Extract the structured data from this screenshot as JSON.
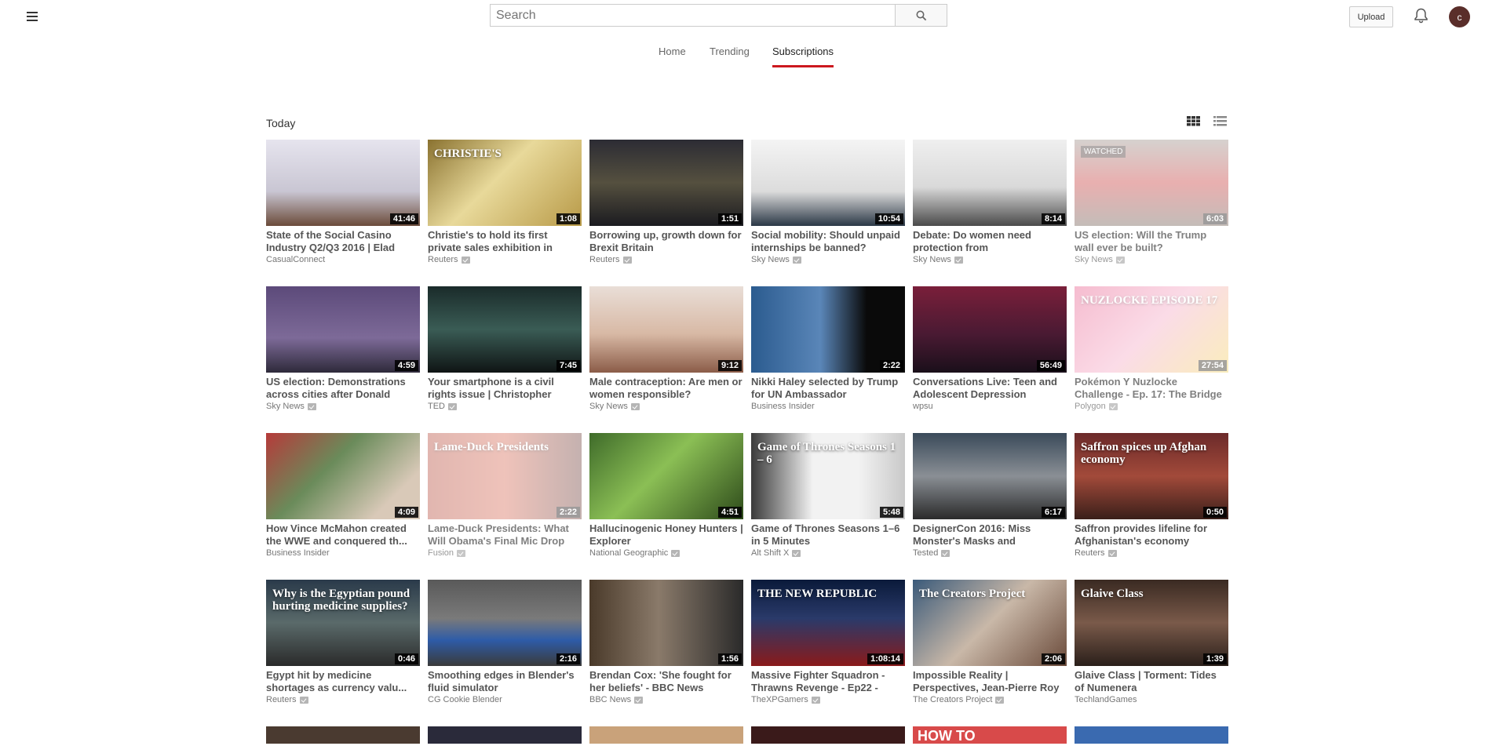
{
  "header": {
    "search_placeholder": "Search",
    "upload_label": "Upload",
    "avatar_initial": "c"
  },
  "tabs": [
    {
      "label": "Home",
      "active": false
    },
    {
      "label": "Trending",
      "active": false
    },
    {
      "label": "Subscriptions",
      "active": true
    }
  ],
  "section": {
    "title": "Today"
  },
  "accent_color": "#cc181e",
  "rows": [
    [
      {
        "title": "State of the Social Casino Industry Q2/Q3 2016 | Elad",
        "channel": "CasualConnect",
        "verified": false,
        "duration": "41:46",
        "bg": "linear-gradient(180deg,#e6e4ee 0%,#c9c6d3 60%,#6b4b3a 100%)"
      },
      {
        "title": "Christie's to hold its first private sales exhibition in",
        "channel": "Reuters",
        "verified": true,
        "duration": "1:08",
        "bg": "linear-gradient(135deg,#8a7230 0%,#e8d99a 45%,#b89a48 100%)",
        "thumb_text": "CHRISTIE'S"
      },
      {
        "title": "Borrowing up, growth down for Brexit Britain",
        "channel": "Reuters",
        "verified": true,
        "duration": "1:51",
        "bg": "linear-gradient(180deg,#2c2c34 0%,#55503f 50%,#1b1b20 100%)"
      },
      {
        "title": "Social mobility: Should unpaid internships be banned?",
        "channel": "Sky News",
        "verified": true,
        "duration": "10:54",
        "bg": "linear-gradient(180deg,#f4f4f4 0%,#dcdcdc 60%,#2b3846 100%)"
      },
      {
        "title": "Debate: Do women need protection from",
        "channel": "Sky News",
        "verified": true,
        "duration": "8:14",
        "bg": "linear-gradient(180deg,#efefef 0%,#d9d9d9 55%,#4a4a4a 100%)"
      },
      {
        "title": "US election: Will the Trump wall ever be built?",
        "channel": "Sky News",
        "verified": true,
        "duration": "6:03",
        "bg": "linear-gradient(180deg,#9a8f88 0%,#c83a3a 50%,#6d5b51 100%)",
        "watched": true,
        "watched_label": "WATCHED"
      }
    ],
    [
      {
        "title": "US election: Demonstrations across cities after Donald",
        "channel": "Sky News",
        "verified": true,
        "duration": "4:59",
        "bg": "linear-gradient(180deg,#5c4a7a 0%,#7d6a98 60%,#2e2a3a 100%)"
      },
      {
        "title": "Your smartphone is a civil rights issue | Christopher",
        "channel": "TED",
        "verified": true,
        "duration": "7:45",
        "bg": "linear-gradient(180deg,#1a2b2a 0%,#3a5c55 50%,#0f1414 100%)"
      },
      {
        "title": "Male contraception: Are men or women responsible?",
        "channel": "Sky News",
        "verified": true,
        "duration": "9:12",
        "bg": "linear-gradient(180deg,#e9ded7 0%,#d8b9a5 55%,#8b5c48 100%)"
      },
      {
        "title": "Nikki Haley selected by Trump for UN Ambassador",
        "channel": "Business Insider",
        "verified": false,
        "duration": "2:22",
        "bg": "linear-gradient(90deg,#2b5b8f 0%,#5a86b8 45%,#0a0a0a 75%)"
      },
      {
        "title": "Conversations Live: Teen and Adolescent Depression",
        "channel": "wpsu",
        "verified": false,
        "duration": "56:49",
        "bg": "linear-gradient(180deg,#7a1f3a 0%,#4a1a33 55%,#1a0f1a 100%)"
      },
      {
        "title": "Pokémon Y Nuzlocke Challenge - Ep. 17: The Bridge",
        "channel": "Polygon",
        "verified": true,
        "duration": "27:54",
        "bg": "linear-gradient(135deg,#e85a8a 0%,#f6a8c5 50%,#f2d35a 100%)",
        "watched": true,
        "thumb_text": "NUZLOCKE EPISODE 17"
      }
    ],
    [
      {
        "title": "How Vince McMahon created the WWE and conquered th...",
        "channel": "Business Insider",
        "verified": false,
        "duration": "4:09",
        "bg": "linear-gradient(135deg,#b63a3a 0%,#6a8b5a 40%,#d9c9b8 80%)"
      },
      {
        "title": "Lame-Duck Presidents: What Will Obama's Final Mic Drop",
        "channel": "Fusion",
        "verified": true,
        "duration": "2:22",
        "bg": "linear-gradient(90deg,#b54b3b 0%,#d86a55 50%,#6f3f3a 100%)",
        "watched": true,
        "thumb_text": "Lame-Duck Presidents"
      },
      {
        "title": "Hallucinogenic Honey Hunters | Explorer",
        "channel": "National Geographic",
        "verified": true,
        "duration": "4:51",
        "bg": "linear-gradient(135deg,#3f6b2a 0%,#8bbf55 45%,#2d4a1a 100%)"
      },
      {
        "title": "Game of Thrones Seasons 1–6 in 5 Minutes",
        "channel": "Alt Shift X",
        "verified": true,
        "duration": "5:48",
        "bg": "linear-gradient(90deg,#3a3a3a 0%,#f2f2f2 40%,#f2f2f2 70%,#c9c9c9 100%)",
        "thumb_text": "Game of Thrones Seasons 1 – 6"
      },
      {
        "title": "DesignerCon 2016: Miss Monster's Masks and",
        "channel": "Tested",
        "verified": true,
        "duration": "6:17",
        "bg": "linear-gradient(180deg,#3a4a5a 0%,#8a8f95 50%,#2a2a2a 100%)"
      },
      {
        "title": "Saffron provides lifeline for Afghanistan's economy",
        "channel": "Reuters",
        "verified": true,
        "duration": "0:50",
        "bg": "linear-gradient(180deg,#6b2a2a 0%,#a24a3a 50%,#3a1f1a 100%)",
        "thumb_text": "Saffron spices up Afghan economy"
      }
    ],
    [
      {
        "title": "Egypt hit by medicine shortages as currency valu...",
        "channel": "Reuters",
        "verified": true,
        "duration": "0:46",
        "bg": "linear-gradient(180deg,#2a3a4a 0%,#5a6a6a 50%,#2a2a2a 100%)",
        "thumb_text": "Why is the Egyptian pound hurting medicine supplies?"
      },
      {
        "title": "Smoothing edges in Blender's fluid simulator",
        "channel": "CG Cookie Blender",
        "verified": false,
        "duration": "2:16",
        "bg": "linear-gradient(180deg,#595959 0%,#7a7a7a 45%,#2e5ca8 70%,#3a3a3a 100%)"
      },
      {
        "title": "Brendan Cox: 'She fought for her beliefs' - BBC News",
        "channel": "BBC News",
        "verified": true,
        "duration": "1:56",
        "bg": "linear-gradient(90deg,#4a3a2a 0%,#8a7a6a 45%,#2a2a2a 100%)"
      },
      {
        "title": "Massive Fighter Squadron - Thrawns Revenge - Ep22 -",
        "channel": "TheXPGamers",
        "verified": true,
        "duration": "1:08:14",
        "bg": "linear-gradient(180deg,#0a1a3a 0%,#2a3a6a 45%,#8a1a1a 100%)",
        "thumb_text": "THE NEW REPUBLIC"
      },
      {
        "title": "Impossible Reality | Perspectives, Jean-Pierre Roy",
        "channel": "The Creators Project",
        "verified": true,
        "duration": "2:06",
        "bg": "linear-gradient(135deg,#3a5a7a 0%,#c9b8a8 50%,#6a4a3a 100%)",
        "thumb_text": "The Creators Project"
      },
      {
        "title": "Glaive Class | Torment: Tides of Numenera",
        "channel": "TechlandGames",
        "verified": false,
        "duration": "1:39",
        "bg": "linear-gradient(180deg,#3a2a22 0%,#7a5a4a 50%,#2a1f1a 100%)",
        "thumb_text": "Glaive Class"
      }
    ]
  ],
  "partial_row_colors": [
    "#4a3a30",
    "#2a2a3a",
    "#c9a27a",
    "#3a1a1a",
    "#d84a4a",
    "#3a6ab0"
  ],
  "partial_row_texts": [
    "",
    "",
    "",
    "",
    "HOW TO",
    ""
  ]
}
